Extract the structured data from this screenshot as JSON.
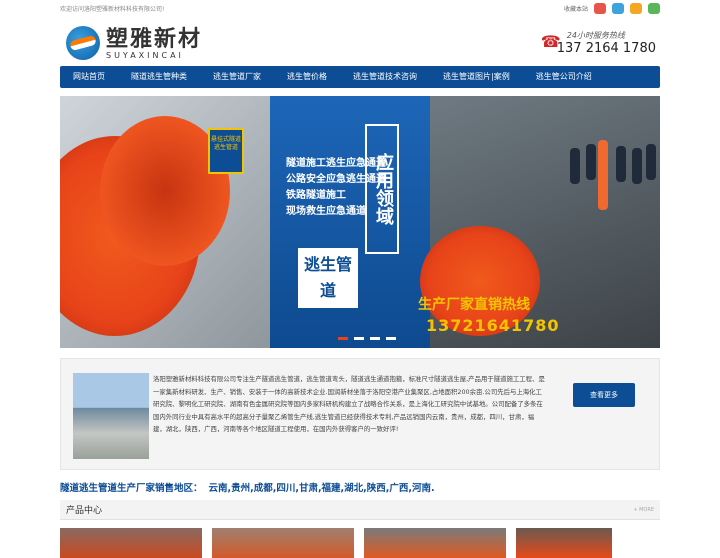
{
  "topbar": {
    "welcome": "欢迎访问洛阳塑雅新材料科技有限公司!",
    "bookmark": "收藏本站",
    "social_icons": [
      "weibo-icon",
      "qq-icon",
      "qzone-icon",
      "wechat-icon"
    ],
    "social_colors": [
      "#e6544c",
      "#3ea3dc",
      "#f5a623",
      "#5ab65a"
    ]
  },
  "logo": {
    "cn": "塑雅新材",
    "en": "SUYAXINCAI"
  },
  "hotline": {
    "label": "24小时服务热线",
    "number": "137 2164 1780"
  },
  "nav": [
    "网站首页",
    "隧道逃生管种类",
    "逃生管道厂家",
    "逃生管价格",
    "逃生管道技术咨询",
    "逃生管道图片|案例",
    "逃生管公司介绍"
  ],
  "banner": {
    "tag": "悬挂式隧道逃生管道",
    "lines": [
      "隧道施工逃生应急通道",
      "公路安全应急逃生通道",
      "铁路隧道施工",
      "现场救生应急通道"
    ],
    "vertical": "应用领域",
    "escape": "逃生管道",
    "hot": "生产厂家直销热线",
    "number": "13721641780"
  },
  "about": {
    "text": "洛阳塑雅新材料科技有限公司专注生产隧道逃生管道，逃生管道弯头，隧道逃生通道抱箍，标准尺寸隧道逃生屋,产品用于隧道施工工程、是一家集新材料研发、生产、销售、安装于一体的高新技术企业.国润新材坐落于洛阳空港产业集聚区,占地面积200余亩.公司先后与上海化工研究院、黎明化工研究院、湖南有色金属研究院等国内多家科研机构建立了战略合作关系，是上海化工研究院中试基地。公司配备了多条在国内外同行业中具有高水平的超高分子量聚乙烯管生产线,逃生管道已经获得技术专利,产品远销国内云南，贵州，成都，四川，甘肃，福建，湖北，陕西，广西，河南等各个地区隧道工程使用，在国内外获得客户的一致好评!",
    "more": "查看更多"
  },
  "region": {
    "label": "隧道逃生管道生产厂家销售地区：",
    "cities": "云南,贵州,成都,四川,甘肃,福建,湖北,陕西,广西,河南."
  },
  "products": {
    "title": "产品中心",
    "more": "+ MORE"
  }
}
